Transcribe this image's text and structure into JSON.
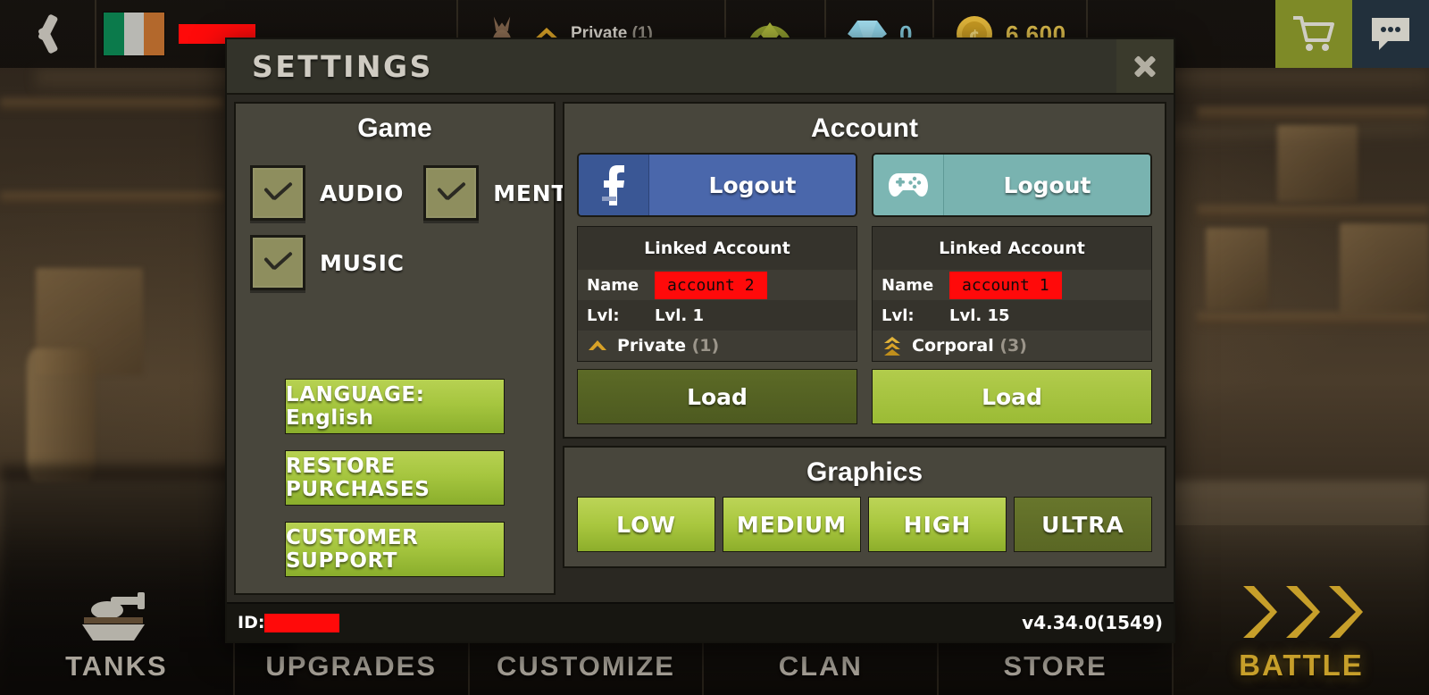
{
  "hud": {
    "back_icon": "back-chevron-icon",
    "flag": "ireland-flag-icon",
    "player_name_redacted": "",
    "rank_label": "Private",
    "rank_count": "(1)",
    "energy_value": "",
    "gem_value": "0",
    "gold_value": "6 600",
    "cart_icon": "shopping-cart-icon",
    "chat_icon": "chat-bubble-icon"
  },
  "bottom_nav": {
    "items": [
      {
        "label": "TANKS"
      },
      {
        "label": "UPGRADES"
      },
      {
        "label": "CUSTOMIZE"
      },
      {
        "label": "CLAN"
      },
      {
        "label": "STORE"
      }
    ],
    "battle_label": "BATTLE"
  },
  "modal": {
    "title": "SETTINGS",
    "close_icon": "close-icon",
    "game": {
      "title": "Game",
      "checkboxes": [
        {
          "label": "AUDIO",
          "checked": true
        },
        {
          "label": "MENTION",
          "checked": true
        },
        {
          "label": "MUSIC",
          "checked": true
        }
      ],
      "buttons": [
        {
          "label": "LANGUAGE: English"
        },
        {
          "label": "RESTORE PURCHASES"
        },
        {
          "label": "CUSTOMER SUPPORT"
        }
      ]
    },
    "account": {
      "title": "Account",
      "columns": [
        {
          "provider_icon": "facebook-icon",
          "logout_label": "Logout",
          "linked_title": "Linked Account",
          "name_key": "Name",
          "name_value": "account 2",
          "lvl_key": "Lvl:",
          "lvl_value": "Lvl. 1",
          "rank_icon": "private-chevron-icon",
          "rank_label": "Private",
          "rank_count": "(1)",
          "load_label": "Load"
        },
        {
          "provider_icon": "gamepad-icon",
          "logout_label": "Logout",
          "linked_title": "Linked Account",
          "name_key": "Name",
          "name_value": "account 1",
          "lvl_key": "Lvl:",
          "lvl_value": "Lvl. 15",
          "rank_icon": "corporal-chevrons-icon",
          "rank_label": "Corporal",
          "rank_count": "(3)",
          "load_label": "Load"
        }
      ]
    },
    "graphics": {
      "title": "Graphics",
      "options": [
        {
          "label": "LOW",
          "selected": false
        },
        {
          "label": "MEDIUM",
          "selected": false
        },
        {
          "label": "HIGH",
          "selected": false
        },
        {
          "label": "ULTRA",
          "selected": true
        }
      ]
    },
    "footer": {
      "id_label": "ID:",
      "id_value_redacted": "",
      "version": "v4.34.0(1549)"
    }
  },
  "colors": {
    "lime": "#a9c73f",
    "lime_dark": "#5c6a26",
    "facebook_blue": "#4a67ab",
    "gamepad_teal": "#79b3b0",
    "redaction_red": "#ff0a0a",
    "panel": "#48463c",
    "modal_bg": "#2a2822",
    "gold": "#d8b84a"
  }
}
